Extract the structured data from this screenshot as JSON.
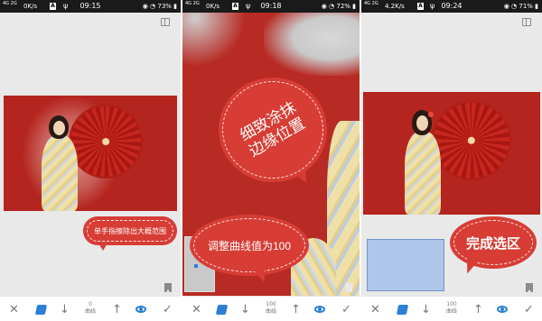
{
  "panels": [
    {
      "status": {
        "signal": "4G 2G",
        "speed": "0K/s",
        "time": "09:15",
        "battery": "73%"
      },
      "callout": "单手指擦除出大概范围",
      "toolbar": {
        "value": "0",
        "label": "曲线"
      }
    },
    {
      "status": {
        "signal": "4G 2G",
        "speed": "0K/s",
        "time": "09:18",
        "battery": "72%"
      },
      "callout_top": "细致涂抹边缘位置",
      "callout_bottom": "调整曲线值为100",
      "toolbar": {
        "value": "100",
        "label": "曲线"
      }
    },
    {
      "status": {
        "signal": "4G 2G",
        "speed": "4.2K/s",
        "time": "09:24",
        "battery": "71%"
      },
      "callout": "完成选区",
      "toolbar": {
        "value": "100",
        "label": "曲线"
      }
    }
  ],
  "colors": {
    "accent_blue": "#2d7fd6",
    "bubble_red": "#d73d35",
    "photo_red": "#b5251f",
    "selection_blue": "#aec6ea"
  },
  "icons": [
    "close-icon",
    "brush-icon",
    "arrow-down-icon",
    "arrow-up-icon",
    "eye-icon",
    "check-icon",
    "compare-icon",
    "bookmark-icon"
  ]
}
